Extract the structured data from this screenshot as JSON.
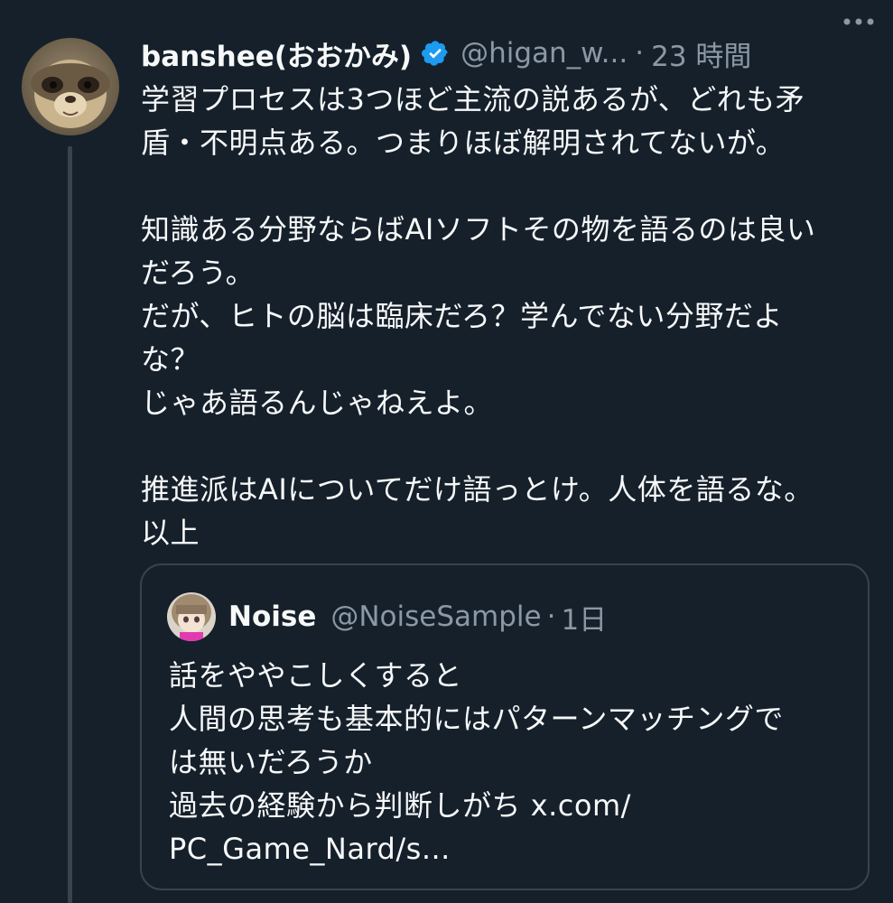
{
  "tweet": {
    "display_name": "banshee(おおかみ)",
    "handle": "@higan_w...",
    "separator": "·",
    "time": "23 時間",
    "more_icon": "more-horizontal-icon",
    "verified_icon": "verified-badge-icon",
    "verified_color": "#1d9bf0",
    "body": "学習プロセスは3つほど主流の説あるが、どれも矛\n盾・不明点ある。つまりほぼ解明されてないが。\n\n知識ある分野ならばAIソフトその物を語るのは良い\nだろう。\nだが、ヒトの脳は臨床だろ？学んでない分野だよ\nな？\nじゃあ語るんじゃねえよ。\n\n推進派はAIについてだけ語っとけ。人体を語るな。\n以上"
  },
  "quote": {
    "display_name": "Noise",
    "handle": "@NoiseSample",
    "separator": "·",
    "time": "1日",
    "body": "話をややこしくすると\n人間の思考も基本的にはパターンマッチングで\nは無いだろうか\n過去の経験から判断しがち x.com/\nPC_Game_Nard/s..."
  },
  "theme": {
    "background": "#15202b",
    "text": "#f7f9f9",
    "secondary": "#8b98a5",
    "border": "#38444d"
  }
}
